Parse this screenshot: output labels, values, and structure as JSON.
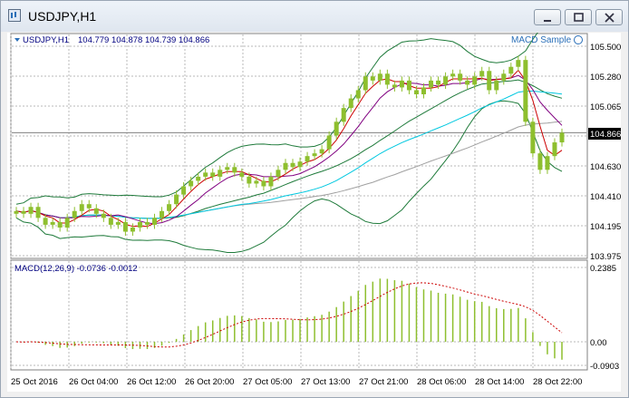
{
  "window": {
    "title": "USDJPY,H1"
  },
  "main_chart": {
    "header_symbol": "USDJPY,H1",
    "header_ohlc": "104.779 104.878 104.739 104.866",
    "indicator_label": "MACD Sample",
    "current_price": "104.866",
    "price_ticks": [
      "105.500",
      "105.280",
      "105.065",
      "104.630",
      "104.410",
      "104.195",
      "103.975"
    ]
  },
  "macd_panel": {
    "label": "MACD(12,26,9) -0.0736 -0.0012",
    "ticks": [
      "0.2385",
      "0.00",
      "-0.0903"
    ]
  },
  "time_axis": {
    "labels": [
      "25 Oct 2016",
      "26 Oct 04:00",
      "26 Oct 12:00",
      "26 Oct 20:00",
      "27 Oct 05:00",
      "27 Oct 13:00",
      "27 Oct 21:00",
      "28 Oct 06:00",
      "28 Oct 14:00",
      "28 Oct 22:00"
    ]
  },
  "colors": {
    "candle": "#8ebf2e",
    "grid": "#b8b8b8",
    "ma_fast": "#cc0000",
    "ma_mid": "#800080",
    "ma_slow": "#00c8e0",
    "ma_long": "#a0a0a0",
    "bands": "#1e7a3a",
    "signal": "#cc0000"
  },
  "chart_data": {
    "type": "candlestick",
    "closes": [
      104.3,
      104.28,
      104.33,
      104.25,
      104.2,
      104.22,
      104.18,
      104.25,
      104.3,
      104.35,
      104.32,
      104.28,
      104.25,
      104.2,
      104.22,
      104.15,
      104.18,
      104.22,
      104.2,
      104.25,
      104.3,
      104.35,
      104.42,
      104.48,
      104.52,
      104.55,
      104.58,
      104.55,
      104.6,
      104.62,
      104.58,
      104.55,
      104.5,
      104.52,
      104.48,
      104.55,
      104.6,
      104.65,
      104.62,
      104.66,
      104.7,
      104.72,
      104.75,
      104.85,
      104.95,
      105.05,
      105.12,
      105.18,
      105.28,
      105.25,
      105.3,
      105.22,
      105.2,
      105.25,
      105.18,
      105.15,
      105.2,
      105.25,
      105.22,
      105.28,
      105.3,
      105.25,
      105.22,
      105.28,
      105.32,
      105.18,
      105.25,
      105.3,
      105.35,
      105.4,
      104.95,
      104.72,
      104.6,
      104.7,
      104.8,
      104.87
    ],
    "price_range": [
      103.975,
      105.5
    ],
    "macd_range": [
      -0.0903,
      0.2385
    ]
  }
}
